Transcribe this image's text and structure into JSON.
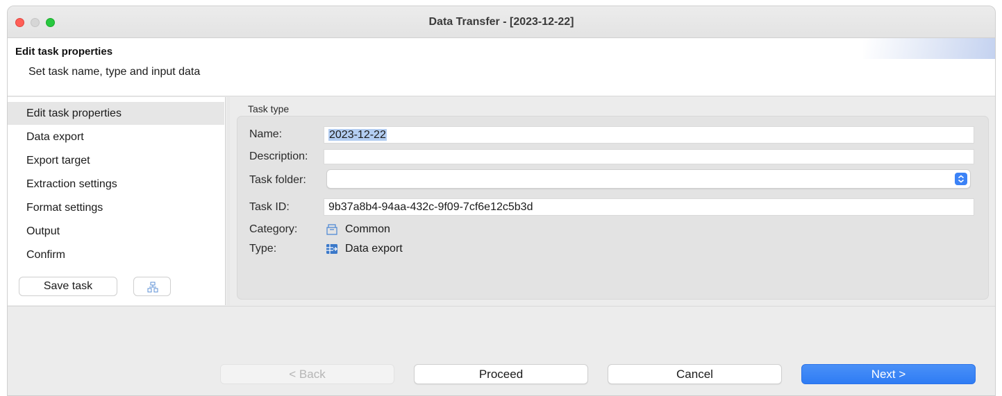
{
  "window": {
    "title": "Data Transfer - [2023-12-22]"
  },
  "header": {
    "title": "Edit task properties",
    "subtitle": "Set task name, type and input data"
  },
  "nav": {
    "items": [
      {
        "label": "Edit task properties",
        "selected": true
      },
      {
        "label": "Data export",
        "selected": false
      },
      {
        "label": "Export target",
        "selected": false
      },
      {
        "label": "Extraction settings",
        "selected": false
      },
      {
        "label": "Format settings",
        "selected": false
      },
      {
        "label": "Output",
        "selected": false
      },
      {
        "label": "Confirm",
        "selected": false
      }
    ],
    "save_label": "Save task",
    "save_icon": "save-to-folder-icon"
  },
  "task": {
    "group_label": "Task type",
    "name_label": "Name:",
    "name_value": "2023-12-22",
    "description_label": "Description:",
    "description_value": "",
    "folder_label": "Task folder:",
    "folder_value": "",
    "id_label": "Task ID:",
    "id_value": "9b37a8b4-94aa-432c-9f09-7cf6e12c5b3d",
    "category_label": "Category:",
    "category_value": "Common",
    "category_icon": "folder-icon",
    "type_label": "Type:",
    "type_value": "Data export",
    "type_icon": "table-export-icon"
  },
  "buttons": {
    "back": "< Back",
    "proceed": "Proceed",
    "cancel": "Cancel",
    "next": "Next >"
  },
  "colors": {
    "accent": "#2f7cf4",
    "selection": "#b3cdf1",
    "close": "#ff5f57",
    "maximize": "#28c840"
  }
}
